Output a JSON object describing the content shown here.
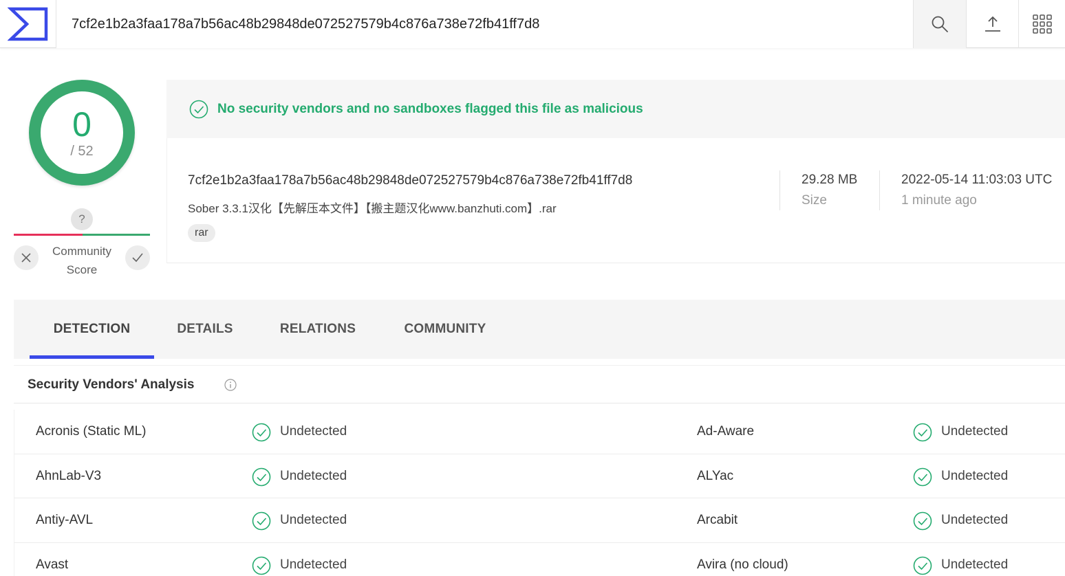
{
  "search": {
    "value": "7cf2e1b2a3faa178a7b56ac48b29848de072527579b4c876a738e72fb41ff7d8"
  },
  "score": {
    "detections": "0",
    "total": "/ 52"
  },
  "community": {
    "unknown_symbol": "?",
    "label_line1": "Community",
    "label_line2": "Score"
  },
  "summary": {
    "banner": "No security vendors and no sandboxes flagged this file as malicious",
    "hash": "7cf2e1b2a3faa178a7b56ac48b29848de072527579b4c876a738e72fb41ff7d8",
    "filename": "Sober 3.3.1汉化【先解压本文件】【搬主题汉化www.banzhuti.com】.rar",
    "tag": "rar",
    "size_value": "29.28 MB",
    "size_label": "Size",
    "date_value": "2022-05-14 11:03:03 UTC",
    "date_relative": "1 minute ago"
  },
  "tabs": [
    {
      "label": "DETECTION"
    },
    {
      "label": "DETAILS"
    },
    {
      "label": "RELATIONS"
    },
    {
      "label": "COMMUNITY"
    }
  ],
  "vendors": {
    "title": "Security Vendors' Analysis",
    "rows": [
      {
        "left": {
          "name": "Acronis (Static ML)",
          "result": "Undetected"
        },
        "right": {
          "name": "Ad-Aware",
          "result": "Undetected"
        }
      },
      {
        "left": {
          "name": "AhnLab-V3",
          "result": "Undetected"
        },
        "right": {
          "name": "ALYac",
          "result": "Undetected"
        }
      },
      {
        "left": {
          "name": "Antiy-AVL",
          "result": "Undetected"
        },
        "right": {
          "name": "Arcabit",
          "result": "Undetected"
        }
      },
      {
        "left": {
          "name": "Avast",
          "result": "Undetected"
        },
        "right": {
          "name": "Avira (no cloud)",
          "result": "Undetected"
        }
      }
    ]
  },
  "colors": {
    "accent": "#3a4ae8",
    "clean": "#24ab6f",
    "malicious": "#e6305a"
  }
}
